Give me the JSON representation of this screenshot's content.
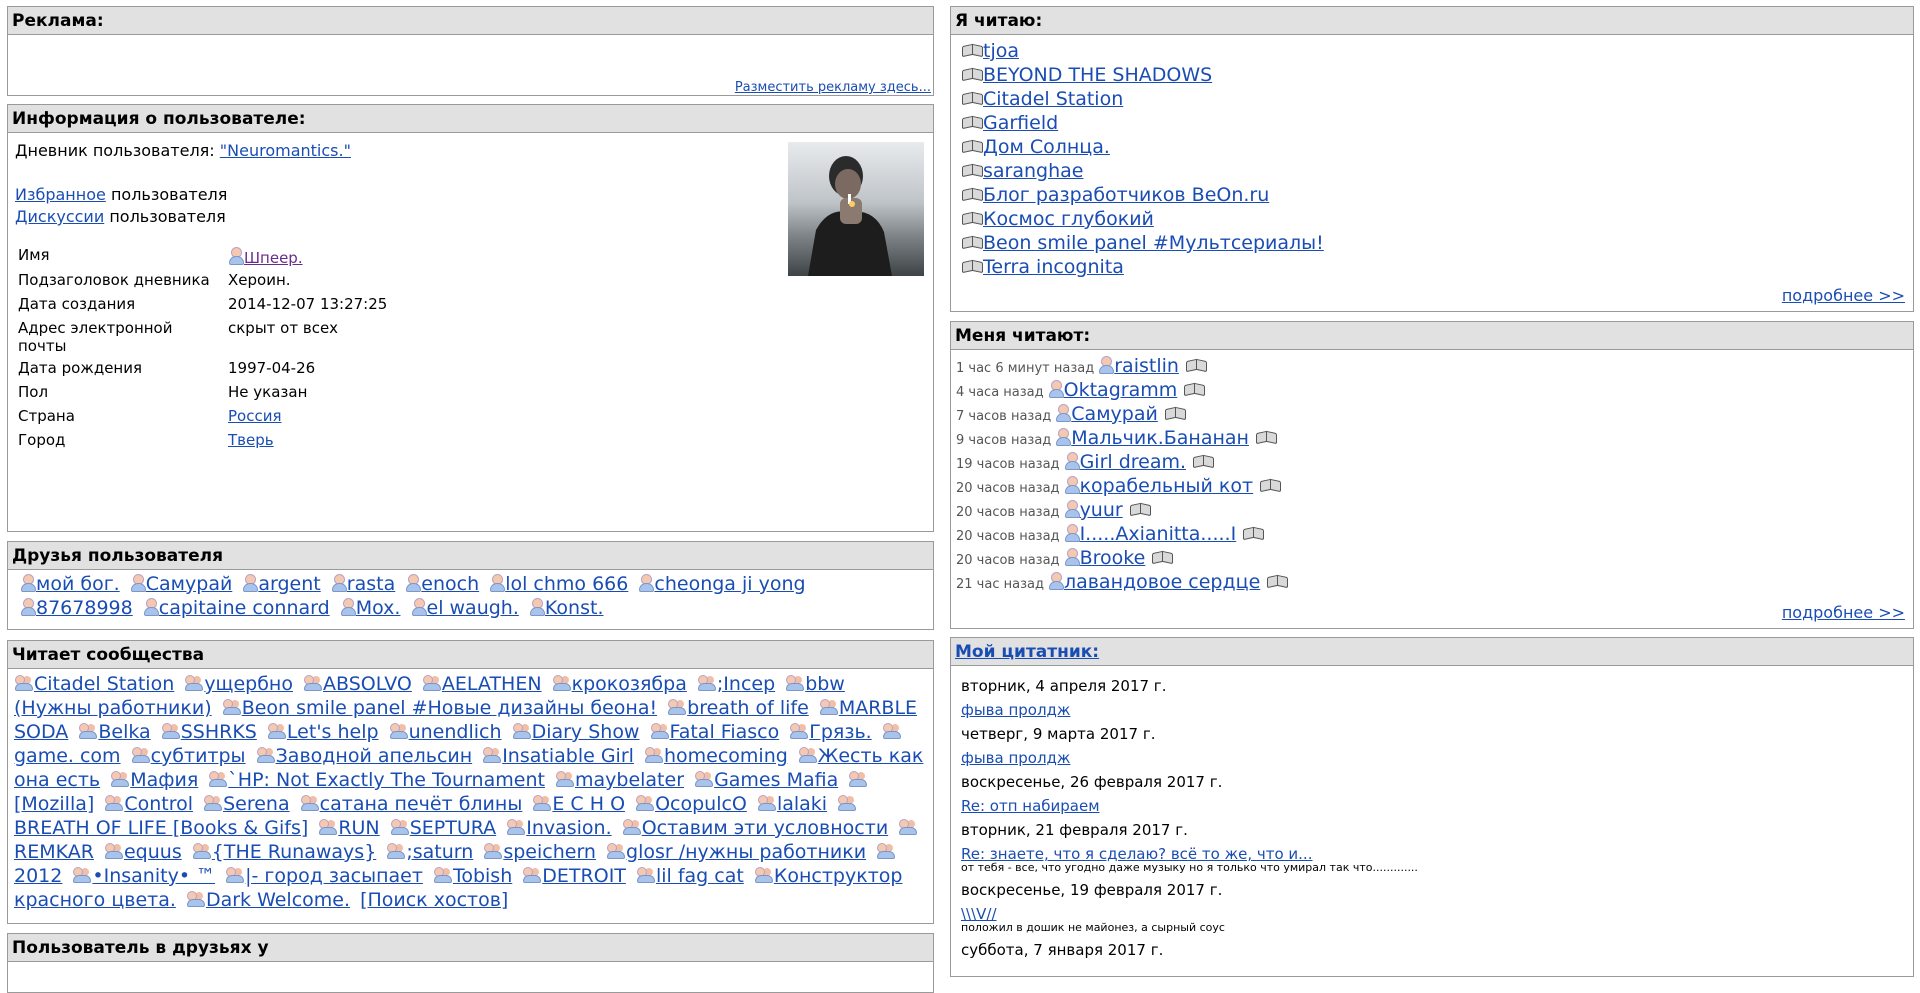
{
  "ads": {
    "title": "Реклама:",
    "place_link": "Разместить рекламу здесь..."
  },
  "user_info": {
    "title": "Информация о пользователе:",
    "diary_label": "Дневник пользователя:",
    "diary_link": "\"Neuromantics.\"",
    "favorites_link": "Избранное",
    "favorites_suffix": "пользователя",
    "discussions_link": "Дискуссии",
    "discussions_suffix": "пользователя",
    "fields": [
      {
        "label": "Имя",
        "value": "Шпеер."
      },
      {
        "label": "Подзаголовок дневника",
        "value": "Хероин."
      },
      {
        "label": "Дата создания",
        "value": "2014-12-07 13:27:25"
      },
      {
        "label": "Адрес электронной почты",
        "value": "скрыт от всех"
      },
      {
        "label": "Дата рождения",
        "value": "1997-04-26"
      },
      {
        "label": "Пол",
        "value": "Не указан"
      },
      {
        "label": "Страна",
        "value": "Россия"
      },
      {
        "label": "Город",
        "value": "Тверь"
      }
    ]
  },
  "friends": {
    "title": "Друзья пользователя",
    "items": [
      "мой бог.",
      "Самурай",
      "argent",
      "rasta",
      "enoch",
      "lol chmo 666",
      "cheonga ji yong",
      "87678998",
      "capitaine connard",
      "Mox.",
      "el waugh.",
      "Konst."
    ]
  },
  "communities": {
    "title": "Читает сообщества",
    "items": [
      "Citadel Station",
      "ущербно",
      "ABSOLVO",
      "AELATHEN",
      "крокозябра",
      ";Incep",
      "bbw (Нужны работники)",
      "Beon smile panel #Новые дизайны беона!",
      "breath of life",
      "MARBLE SODA",
      "Belka",
      "SSHRKS",
      "Let's help",
      "unendlich",
      "Diary Show",
      "Fatal Fiasco",
      "Грязь.",
      "game. com",
      "субтитры",
      "Заводной апельсин",
      "Insatiable Girl",
      "homecoming",
      "Жесть как она есть",
      "Мафия",
      "`HP: Not Exactly The Tournament",
      "maybelater",
      "Games Mafia",
      "[Mozilla]",
      "Control",
      "Serena",
      "сатана печёт блины",
      "E C H O",
      "OcopulcO",
      "lalaki",
      "BREATH OF LIFE [Books & Gifs]",
      "RUN",
      "SEPTURA",
      "Invasion.",
      "Оставим эти условности",
      "REMKAR",
      "equus",
      "{THE Runaways}",
      ";saturn",
      "speichern",
      "glosr /нужны работники",
      "2012",
      "•Insanity• ™",
      "|- город засыпает",
      "Tobish",
      "DETROIT",
      "lil fag cat",
      "Конструктор красного цвета.",
      "Dark Welcome."
    ],
    "search_link": "[Поиск хостов]"
  },
  "in_friends_of": {
    "title": "Пользователь в друзьях у"
  },
  "reading": {
    "title": "Я читаю:",
    "items": [
      "tjoa",
      "BEYOND THE SHADOWS",
      "Citadel Station",
      "Garfield",
      "Дом Солнца.",
      "saranghae",
      "Блог разработчиков BeOn.ru",
      "Космос глубокий",
      "Beon smile panel #Мультсериалы!",
      "Terra incognita"
    ],
    "more": "подробнее >>"
  },
  "readers": {
    "title": "Меня читают:",
    "items": [
      {
        "time": "1 час 6 минут назад",
        "name": "raistlin"
      },
      {
        "time": "4 часа назад",
        "name": "Oktagramm"
      },
      {
        "time": "7 часов назад",
        "name": "Самурай"
      },
      {
        "time": "9 часов назад",
        "name": "Мальчик.Бананан"
      },
      {
        "time": "19 часов назад",
        "name": "Girl dream."
      },
      {
        "time": "20 часов назад",
        "name": "корабельный кот"
      },
      {
        "time": "20 часов назад",
        "name": "yuur"
      },
      {
        "time": "20 часов назад",
        "name": "I.....Axianitta.....I"
      },
      {
        "time": "20 часов назад",
        "name": "Brooke"
      },
      {
        "time": "21 час назад",
        "name": "лавандовое сердце"
      }
    ],
    "more": "подробнее >>"
  },
  "quotes": {
    "title": "Мой цитатник:",
    "entries": [
      {
        "date": "вторник, 4 апреля 2017 г.",
        "link": "фыва пролдж",
        "text": ""
      },
      {
        "date": "четверг, 9 марта 2017 г.",
        "link": "фыва пролдж",
        "text": ""
      },
      {
        "date": "воскресенье, 26 февраля 2017 г.",
        "link": "Re: отп набираем",
        "text": ""
      },
      {
        "date": "вторник, 21 февраля 2017 г.",
        "link": "Re: знаете, что я сделаю? всё то же, что и...",
        "text": "от тебя - все, что угодно даже музыку но я только что умирал так что............."
      },
      {
        "date": "воскресенье, 19 февраля 2017 г.",
        "link": "\\\\\\V//",
        "text": "положил в дошик не майонез, а сырный соус"
      },
      {
        "date": "суббота, 7 января 2017 г.",
        "link": "",
        "text": ""
      }
    ]
  }
}
